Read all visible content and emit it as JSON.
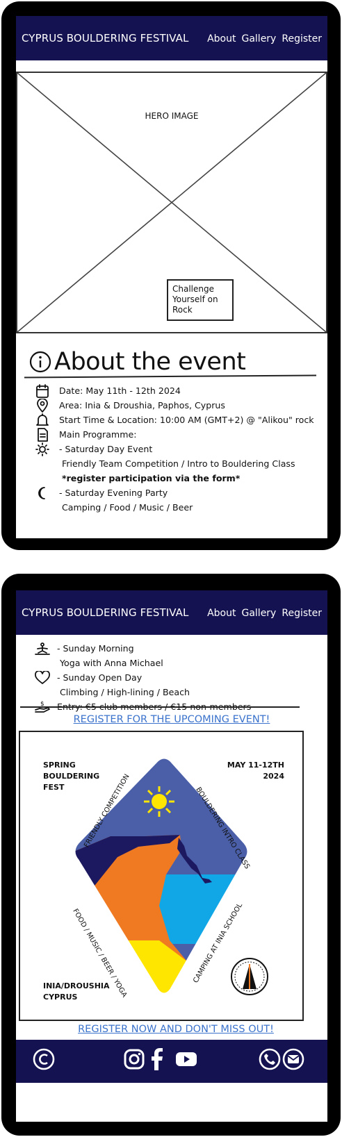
{
  "nav": {
    "title": "CYPRUS BOULDERING FESTIVAL",
    "links": [
      "About",
      "Gallery",
      "Register"
    ]
  },
  "hero": {
    "label": "HERO IMAGE",
    "badge": "Challenge Yourself on Rock"
  },
  "about": {
    "title": "About the event",
    "items": [
      {
        "icon": "calendar-icon",
        "text": "Date: May 11th - 12th 2024"
      },
      {
        "icon": "location-pin-icon",
        "text": "Area: Inia & Droushia, Paphos, Cyprus"
      },
      {
        "icon": "bell-icon",
        "text": "Start Time & Location: 10:00 AM (GMT+2) @ \"Alikou\" rock"
      },
      {
        "icon": "document-icon",
        "text": "Main Programme:"
      },
      {
        "icon": "sun-icon",
        "text": "- Saturday Day Event"
      },
      {
        "icon": "",
        "text": "Friendly Team Competition / Intro to Bouldering Class"
      },
      {
        "icon": "",
        "text": "*register participation via the form*"
      },
      {
        "icon": "moon-icon",
        "text": "- Saturday Evening Party"
      },
      {
        "icon": "",
        "text": "Camping / Food / Music / Beer"
      }
    ],
    "items2": [
      {
        "icon": "yoga-icon",
        "text": "- Sunday Morning"
      },
      {
        "icon": "",
        "text": "Yoga with Anna Michael"
      },
      {
        "icon": "heart-icon",
        "text": "- Sunday Open Day"
      },
      {
        "icon": "",
        "text": "Climbing / High-lining / Beach"
      },
      {
        "icon": "money-hand-icon",
        "text": "Entry: €5 club members / €15 non-members"
      }
    ]
  },
  "register": {
    "link_top": "REGISTER FOR THE UPCOMING EVENT!",
    "link_bottom": "REGISTER NOW AND DON'T MISS OUT!"
  },
  "poster": {
    "title_left": [
      "SPRING",
      "BOULDERING",
      "FEST"
    ],
    "date_right": [
      "MAY 11-12TH",
      "2024"
    ],
    "location": [
      "INIA/DROUSHIA",
      "CYPRUS"
    ],
    "edge_top_left": "FRIENDLY COMPETITION",
    "edge_top_right": "BOULDERING INTRO CLASS",
    "edge_bottom_left": "FOOD / MUSIC / BEER / YOGA",
    "edge_bottom_right": "CAMPING AT INIA SCHOOL",
    "colors": {
      "sky": "#4a5fa8",
      "sea": "#11a7e6",
      "rock": "#f07a22",
      "sun": "#ffe600",
      "dark": "#1d1960"
    }
  },
  "footer": {
    "icons": [
      "copyright-icon",
      "instagram-icon",
      "facebook-icon",
      "youtube-icon",
      "phone-icon",
      "email-icon"
    ]
  },
  "colors": {
    "navbar": "#141250",
    "link": "#3b73cc"
  }
}
